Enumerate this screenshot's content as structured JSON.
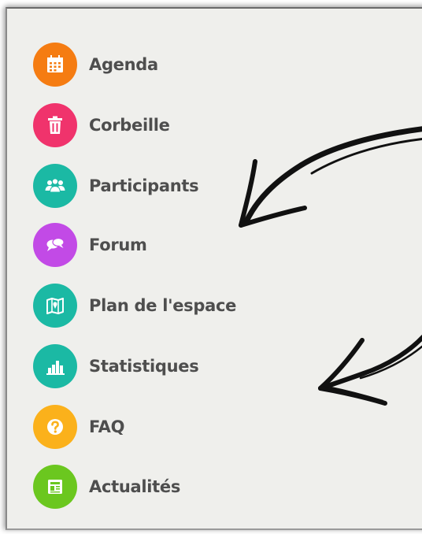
{
  "menu": {
    "items": [
      {
        "label": "Agenda",
        "icon": "calendar-icon",
        "color": "#f57c12"
      },
      {
        "label": "Corbeille",
        "icon": "trash-icon",
        "color": "#f0336c"
      },
      {
        "label": "Participants",
        "icon": "people-icon",
        "color": "#1bb9a4"
      },
      {
        "label": "Forum",
        "icon": "chat-bubbles-icon",
        "color": "#c24ae6"
      },
      {
        "label": "Plan de l'espace",
        "icon": "map-icon",
        "color": "#1bb9a4"
      },
      {
        "label": "Statistiques",
        "icon": "bar-chart-icon",
        "color": "#1bb9a4"
      },
      {
        "label": "FAQ",
        "icon": "question-icon",
        "color": "#fbb11b"
      },
      {
        "label": "Actualités",
        "icon": "news-icon",
        "color": "#6bc71f"
      }
    ]
  },
  "annotation": {
    "color": "#111111"
  }
}
